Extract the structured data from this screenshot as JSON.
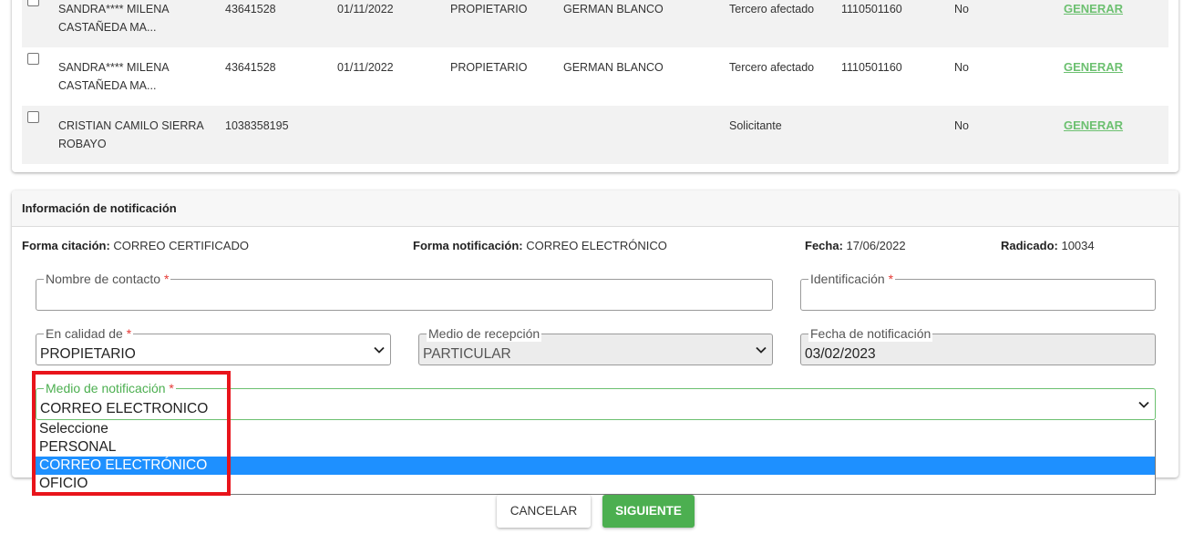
{
  "table": {
    "rows": [
      {
        "name": "SANDRA**** MILENA CASTAÑEDA MA...",
        "id": "43641528",
        "date": "01/11/2022",
        "role": "PROPIETARIO",
        "person": "GERMAN BLANCO",
        "type": "Tercero afectado",
        "number": "1110501160",
        "flag": "No",
        "action": "GENERAR"
      },
      {
        "name": "SANDRA**** MILENA CASTAÑEDA MA...",
        "id": "43641528",
        "date": "01/11/2022",
        "role": "PROPIETARIO",
        "person": "GERMAN BLANCO",
        "type": "Tercero afectado",
        "number": "1110501160",
        "flag": "No",
        "action": "GENERAR"
      },
      {
        "name": "CRISTIAN CAMILO SIERRA ROBAYO",
        "id": "1038358195",
        "date": "",
        "role": "",
        "person": "",
        "type": "Solicitante",
        "number": "",
        "flag": "No",
        "action": "GENERAR"
      }
    ]
  },
  "notification": {
    "title": "Información de notificación",
    "forma_citacion_label": "Forma citación:",
    "forma_citacion_value": "CORREO CERTIFICADO",
    "forma_notificacion_label": "Forma notificación:",
    "forma_notificacion_value": "CORREO ELECTRÓNICO",
    "fecha_label": "Fecha:",
    "fecha_value": "17/06/2022",
    "radicado_label": "Radicado:",
    "radicado_value": "10034",
    "fields": {
      "nombre": {
        "label": "Nombre de contacto",
        "required": "*",
        "value": ""
      },
      "identificacion": {
        "label": "Identificación",
        "required": "*",
        "value": ""
      },
      "calidad": {
        "label": "En calidad de",
        "required": "*",
        "value": "PROPIETARIO"
      },
      "medio_recepcion": {
        "label": "Medio de recepción",
        "value": "PARTICULAR"
      },
      "fecha_notificacion": {
        "label": "Fecha de notificación",
        "value": "03/02/2023"
      },
      "medio_notificacion": {
        "label": "Medio de notificación",
        "required": "*",
        "value": "CORREO ELECTRONICO"
      }
    },
    "dropdown_options": [
      "Seleccione",
      "PERSONAL",
      "CORREO ELECTRÓNICO",
      "OFICIO"
    ],
    "dropdown_selected_index": 2
  },
  "buttons": {
    "cancel": "CANCELAR",
    "next": "SIGUIENTE"
  },
  "colors": {
    "accent_green": "#4caf50",
    "link_green": "#6cc070",
    "highlight_red": "#e8141b",
    "option_selected_blue": "#1e90ff"
  }
}
